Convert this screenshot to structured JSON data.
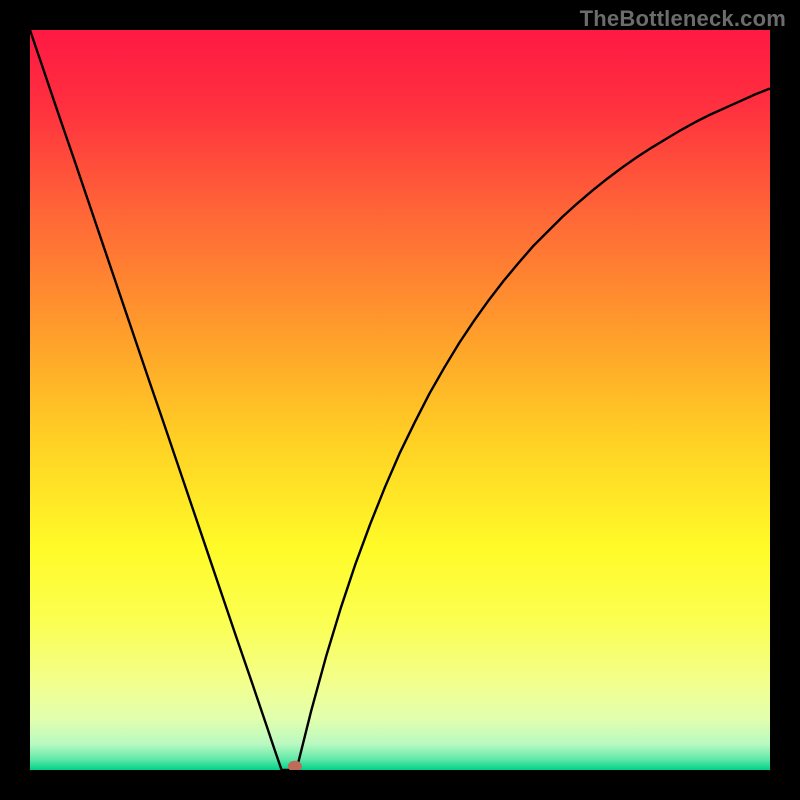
{
  "watermark": {
    "text": "TheBottleneck.com"
  },
  "chart_data": {
    "type": "line",
    "title": "",
    "xlabel": "",
    "ylabel": "",
    "xlim": [
      0,
      100
    ],
    "ylim": [
      0,
      100
    ],
    "curve_x": [
      0,
      2,
      4,
      6,
      8,
      10,
      12,
      14,
      16,
      18,
      20,
      22,
      24,
      26,
      28,
      30,
      32,
      33,
      34,
      35,
      36,
      37,
      38,
      40,
      42,
      44,
      46,
      48,
      50,
      52,
      54,
      56,
      58,
      60,
      62,
      64,
      66,
      68,
      70,
      72,
      74,
      76,
      78,
      80,
      82,
      84,
      86,
      88,
      90,
      92,
      94,
      96,
      98,
      100
    ],
    "curve_y": [
      100,
      94.1,
      88.2,
      82.4,
      76.5,
      70.6,
      64.7,
      58.8,
      52.9,
      47.1,
      41.2,
      35.3,
      29.4,
      23.5,
      17.6,
      11.8,
      5.9,
      2.9,
      0.0,
      0.0,
      0.0,
      4.0,
      8.0,
      15.3,
      21.9,
      27.9,
      33.3,
      38.3,
      42.9,
      47.0,
      50.9,
      54.4,
      57.7,
      60.7,
      63.5,
      66.1,
      68.5,
      70.8,
      72.8,
      74.8,
      76.6,
      78.3,
      79.9,
      81.4,
      82.8,
      84.1,
      85.3,
      86.5,
      87.6,
      88.6,
      89.5,
      90.4,
      91.3,
      92.1
    ],
    "marker": {
      "x": 35.8,
      "y": 0.5,
      "color": "#c06a5a"
    },
    "gradient_stops": [
      {
        "offset": 0.0,
        "color": "#ff1944"
      },
      {
        "offset": 0.1,
        "color": "#ff2f3f"
      },
      {
        "offset": 0.25,
        "color": "#ff6737"
      },
      {
        "offset": 0.4,
        "color": "#ff9a2c"
      },
      {
        "offset": 0.55,
        "color": "#ffcf24"
      },
      {
        "offset": 0.7,
        "color": "#fffb28"
      },
      {
        "offset": 0.8,
        "color": "#fbff52"
      },
      {
        "offset": 0.88,
        "color": "#f3ff8b"
      },
      {
        "offset": 0.93,
        "color": "#e2ffae"
      },
      {
        "offset": 0.965,
        "color": "#b9f9c1"
      },
      {
        "offset": 0.985,
        "color": "#63e9a9"
      },
      {
        "offset": 1.0,
        "color": "#00d18a"
      }
    ]
  }
}
